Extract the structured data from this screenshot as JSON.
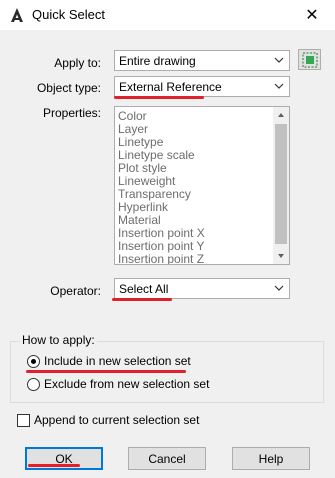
{
  "window": {
    "title": "Quick Select",
    "close_glyph": "✕"
  },
  "apply_to": {
    "label": "Apply to:",
    "value": "Entire drawing"
  },
  "object_type": {
    "label": "Object type:",
    "value": "External Reference"
  },
  "properties": {
    "label": "Properties:",
    "items": [
      "Color",
      "Layer",
      "Linetype",
      "Linetype scale",
      "Plot style",
      "Lineweight",
      "Transparency",
      "Hyperlink",
      "Material",
      "Insertion point X",
      "Insertion point Y",
      "Insertion point Z"
    ]
  },
  "operator": {
    "label": "Operator:",
    "value": "Select All"
  },
  "how_to_apply": {
    "label": "How to apply:",
    "include_label": "Include in new selection set",
    "exclude_label": "Exclude from new selection set",
    "selected": "include"
  },
  "append": {
    "label": "Append to current selection set",
    "checked": false
  },
  "buttons": {
    "ok": "OK",
    "cancel": "Cancel",
    "help": "Help"
  },
  "colors": {
    "annotation_red": "#e0202a",
    "focus_blue": "#0078d7",
    "disabled_text": "#6d6d6d"
  },
  "icons": {
    "app": "autocad-logo-icon",
    "select_objects": "select-objects-icon"
  }
}
